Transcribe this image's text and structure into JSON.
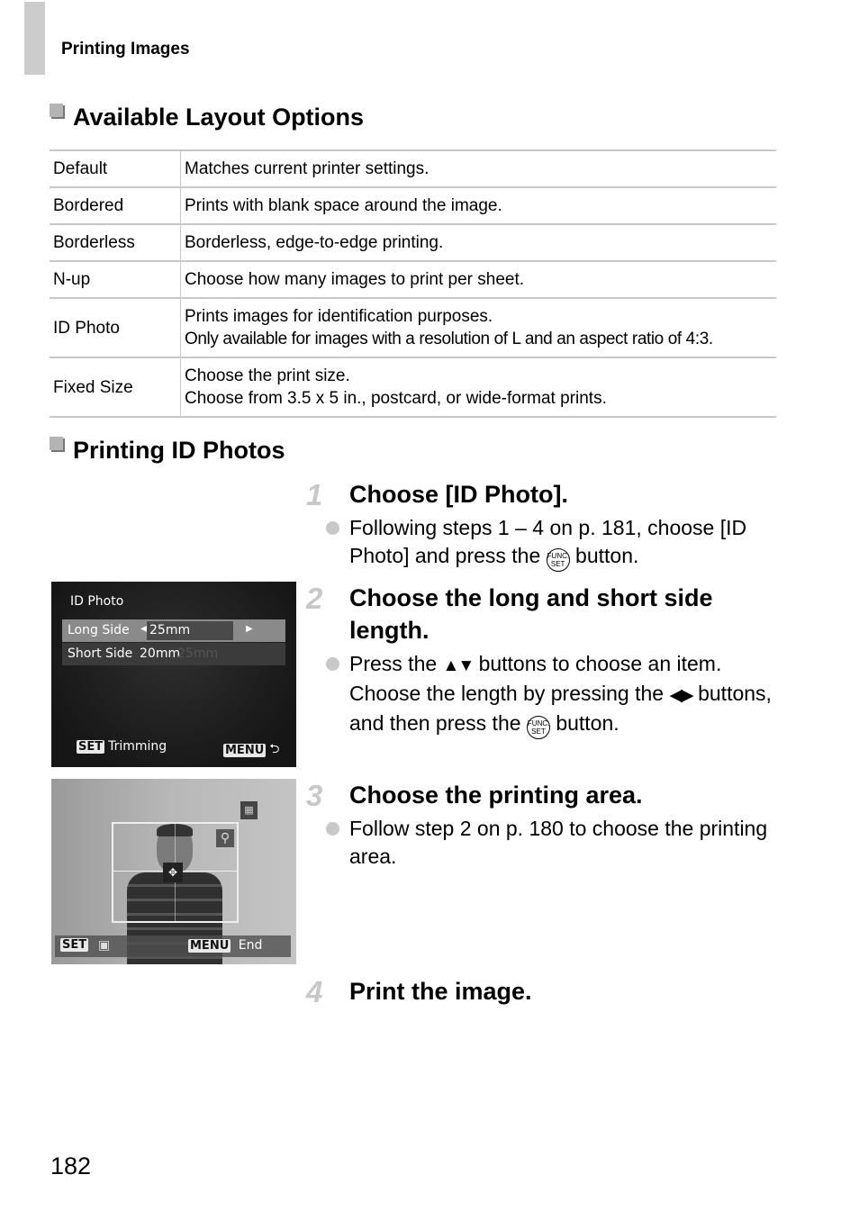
{
  "header": {
    "running_title": "Printing Images"
  },
  "section1": {
    "title": "Available Layout Options",
    "rows": [
      {
        "option": "Default",
        "description": [
          "Matches current printer settings."
        ]
      },
      {
        "option": "Bordered",
        "description": [
          "Prints with blank space around the image."
        ]
      },
      {
        "option": "Borderless",
        "description": [
          "Borderless, edge-to-edge printing."
        ]
      },
      {
        "option": "N-up",
        "description": [
          "Choose how many images to print per sheet."
        ]
      },
      {
        "option": "ID Photo",
        "description": [
          "Prints images for identification purposes.",
          "Only available for images with a resolution of L and an aspect ratio of 4:3."
        ]
      },
      {
        "option": "Fixed Size",
        "description": [
          "Choose the print size.",
          "Choose from 3.5 x 5 in., postcard, or wide-format prints."
        ]
      }
    ]
  },
  "section2": {
    "title": "Printing ID Photos",
    "steps": [
      {
        "num": "1",
        "title": "Choose [ID Photo].",
        "bullet_a": "Following steps 1 – 4 on p. 181, choose [ID Photo] and press the",
        "bullet_b": "button."
      },
      {
        "num": "2",
        "title": "Choose the long and short side length.",
        "bullet_a": "Press the",
        "bullet_b": "buttons to choose an item. Choose the length by pressing the",
        "bullet_c": "buttons, and then press the",
        "bullet_d": "button."
      },
      {
        "num": "3",
        "title": "Choose the printing area.",
        "bullet_a": "Follow step 2 on p. 180 to choose the printing area."
      },
      {
        "num": "4",
        "title": "Print the image."
      }
    ],
    "icons": {
      "func_top": "FUNC.",
      "func_bottom": "SET",
      "up_down": "▲▼",
      "left_right": "◀▶"
    }
  },
  "screen1": {
    "title": "ID Photo",
    "rows": [
      {
        "label": "Long Side",
        "value": "25mm"
      },
      {
        "label": "Short Side",
        "value": "20mm",
        "ghost": "25mm"
      }
    ],
    "footer_left_key": "SET",
    "footer_left_label": "Trimming",
    "footer_right_key": "MENU",
    "footer_right_icon": "⮌"
  },
  "screen2": {
    "footer_left_key": "SET",
    "footer_right_key": "MENU",
    "footer_right_label": "End"
  },
  "page_number": "182"
}
